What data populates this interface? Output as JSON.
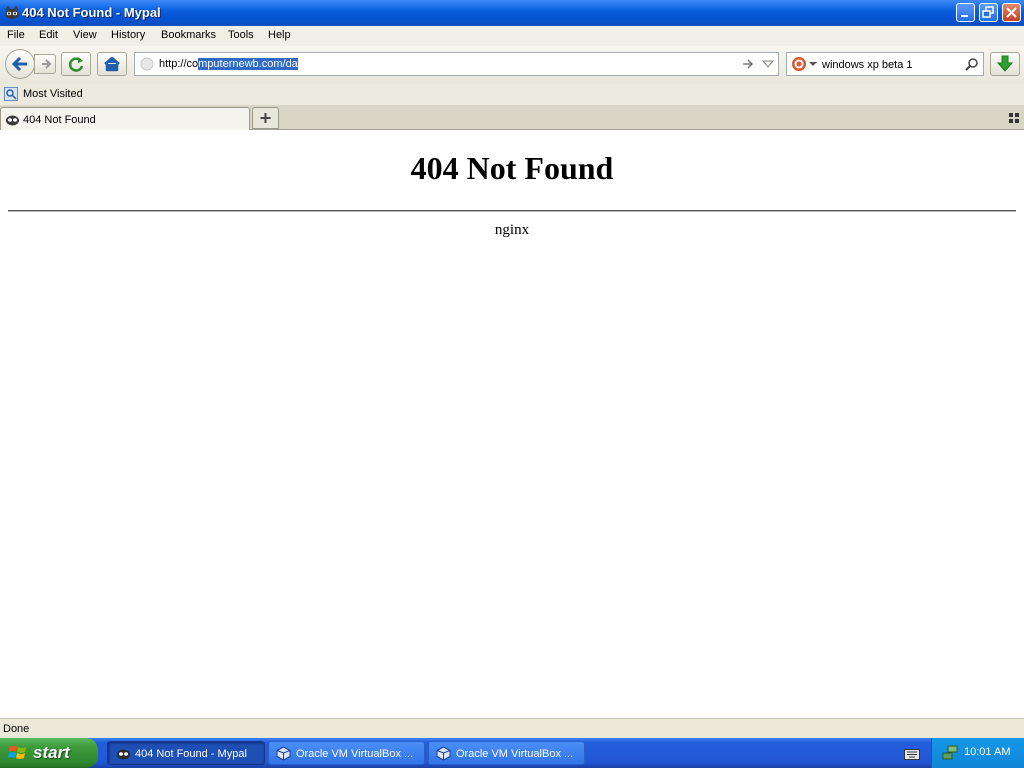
{
  "window": {
    "title": "404 Not Found - Mypal"
  },
  "menu": {
    "items": [
      "File",
      "Edit",
      "View",
      "History",
      "Bookmarks",
      "Tools",
      "Help"
    ]
  },
  "navigation": {
    "url_prefix": "http://co",
    "url_selected": "mputernewb.com/da",
    "search_value": "windows xp beta 1"
  },
  "bookmarks": {
    "most_visited": "Most Visited"
  },
  "tabs": [
    {
      "label": "404 Not Found"
    }
  ],
  "page": {
    "heading": "404 Not Found",
    "server": "nginx"
  },
  "status": {
    "text": "Done"
  },
  "taskbar": {
    "start_label": "start",
    "tasks": [
      {
        "label": "404 Not Found - Mypal"
      },
      {
        "label": "Oracle VM VirtualBox ..."
      },
      {
        "label": "Oracle VM VirtualBox ..."
      }
    ],
    "clock": "10:01 AM"
  },
  "colors": {
    "titlebar": "#0553d2",
    "taskbar": "#245edc",
    "start_button": "#3c9a3c",
    "selection": "#316ac5"
  }
}
